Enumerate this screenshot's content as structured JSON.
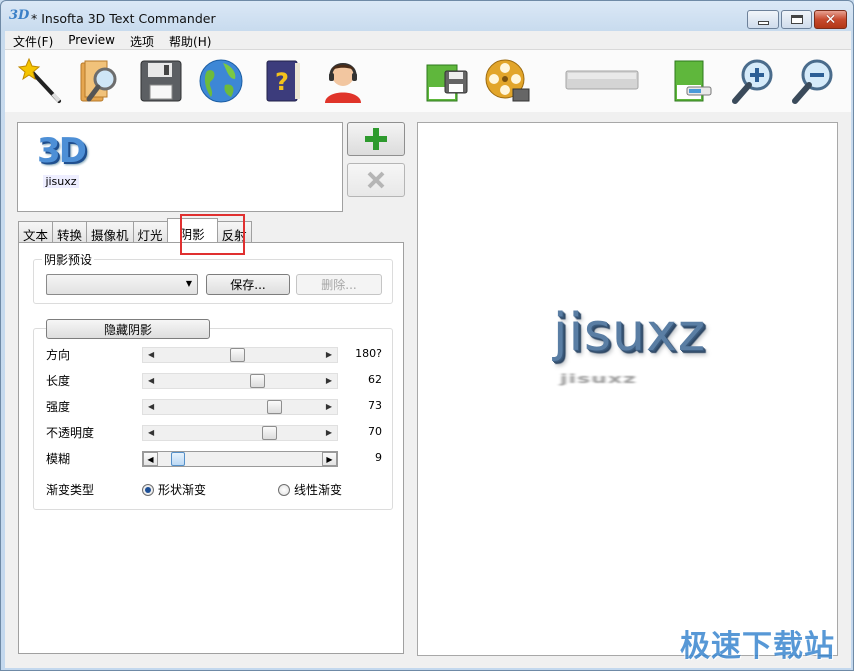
{
  "window": {
    "title": "* Insofta 3D Text Commander",
    "app_icon_text": "3D"
  },
  "menu": [
    {
      "label": "文件(F)"
    },
    {
      "label": "Preview"
    },
    {
      "label": "选项"
    },
    {
      "label": "帮助(H)"
    }
  ],
  "toolbar": {
    "tools": [
      "magic-wand",
      "open-folder-search",
      "save-disk",
      "globe-web",
      "help-book",
      "support-agent",
      "save-image",
      "video-reel",
      "blank-bar",
      "export-picture",
      "zoom-in",
      "zoom-out"
    ]
  },
  "items": {
    "thumbnail_text": "3D",
    "thumbnail_label": "jisuxz"
  },
  "tabs": [
    {
      "label": "文本"
    },
    {
      "label": "转换"
    },
    {
      "label": "摄像机"
    },
    {
      "label": "灯光"
    },
    {
      "label": "阴影",
      "active": true
    },
    {
      "label": "反射"
    }
  ],
  "shadow_panel": {
    "preset_group_label": "阴影预设",
    "preset_value": "",
    "save_label": "保存...",
    "delete_label": "删除...",
    "hide_shadow_label": "隐藏阴影",
    "rows": [
      {
        "label": "方向",
        "value": "180?",
        "level": 0.48
      },
      {
        "label": "长度",
        "value": "62",
        "level": 0.62
      },
      {
        "label": "强度",
        "value": "73",
        "level": 0.73
      },
      {
        "label": "不透明度",
        "value": "70",
        "level": 0.7
      },
      {
        "label": "模糊",
        "value": "9",
        "level": 0.09
      }
    ],
    "gradient_type_label": "渐变类型",
    "radio_shape": "形状渐变",
    "radio_linear": "线性渐变",
    "selected_gradient": "形状渐变"
  },
  "preview": {
    "text": "jisuxz",
    "shadow_text": "jisuxz"
  },
  "watermark": "极速下载站",
  "colors": {
    "title_gradient": "#c8dbee",
    "highlight_box": "#e03030",
    "preview_text": "#5a7ea4",
    "add_icon": "#2e9a2e",
    "del_icon": "#b5b5b5"
  }
}
